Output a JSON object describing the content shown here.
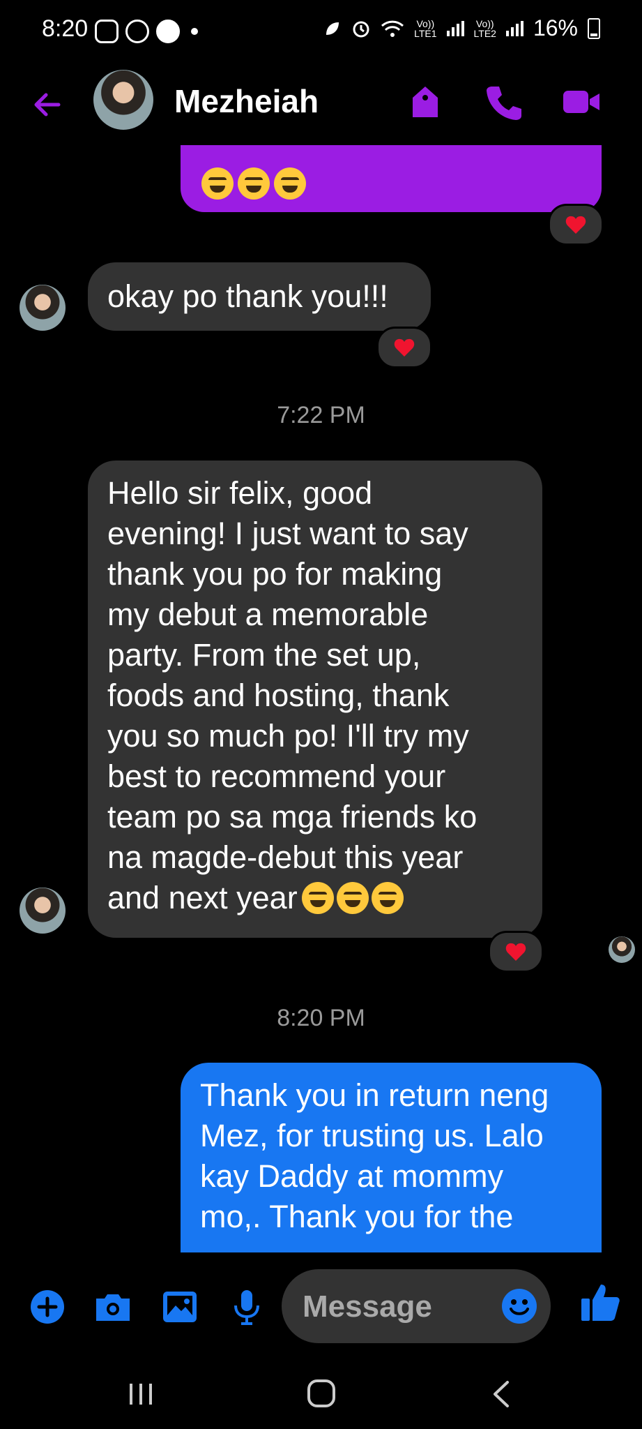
{
  "status_bar": {
    "time": "8:20",
    "left_icons": [
      "instagram-icon",
      "messenger-icon",
      "facebook-icon"
    ],
    "right_labels": {
      "sim1": "Vo))\nLTE1",
      "sim2": "Vo))\nLTE2"
    },
    "battery": "16%"
  },
  "header": {
    "contact_name": "Mezheiah",
    "accent_color": "#9b1de3",
    "icons": [
      "back-arrow-icon",
      "tag-icon",
      "phone-icon",
      "video-call-icon"
    ]
  },
  "chat": {
    "messages": [
      {
        "direction": "outgoing",
        "text": "",
        "color": "#9b1de3",
        "reaction": "heart"
      },
      {
        "direction": "incoming",
        "text": "okay po thank you!!!",
        "reaction": "heart"
      },
      {
        "direction": "incoming",
        "text": "Hello sir felix, good\nevening! I just want to say\nthank you po for making\nmy debut a memorable\nparty. From the set up,\nfoods and hosting, thank\nyou so much po! I'll try my\nbest to recommend your\nteam po sa mga friends ko\nna magde-debut this year\nand next year",
        "reaction": "heart"
      },
      {
        "direction": "outgoing",
        "text": "Thank you in return neng\nMez, for trusting us. Lalo\nkay Daddy at mommy\nmo,. Thank you for the",
        "color": "#1877f2"
      }
    ],
    "timestamps": [
      "7:22 PM",
      "8:20 PM"
    ]
  },
  "composer": {
    "placeholder": "Message",
    "accent_color": "#1877f2",
    "icons": [
      "plus-icon",
      "camera-icon",
      "gallery-icon",
      "microphone-icon",
      "emoji-icon",
      "thumbs-up-icon"
    ]
  },
  "navbar": {
    "icons": [
      "recent-apps-icon",
      "home-icon",
      "back-icon"
    ]
  }
}
